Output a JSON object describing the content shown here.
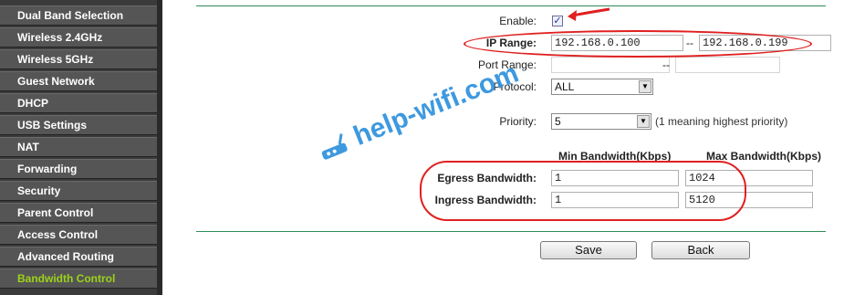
{
  "sidebar": {
    "items": [
      {
        "label": "Dual Band Selection"
      },
      {
        "label": "Wireless 2.4GHz"
      },
      {
        "label": "Wireless 5GHz"
      },
      {
        "label": "Guest Network"
      },
      {
        "label": "DHCP"
      },
      {
        "label": "USB Settings"
      },
      {
        "label": "NAT"
      },
      {
        "label": "Forwarding"
      },
      {
        "label": "Security"
      },
      {
        "label": "Parent Control"
      },
      {
        "label": "Access Control"
      },
      {
        "label": "Advanced Routing"
      },
      {
        "label": "Bandwidth Control"
      }
    ],
    "active_index": 12,
    "active_color": "#9bd31a"
  },
  "form": {
    "enable": {
      "label": "Enable:",
      "checked": true
    },
    "ip_range": {
      "label": "IP Range:",
      "start": "192.168.0.100",
      "separator": "--",
      "end": "192.168.0.199"
    },
    "port_range": {
      "label": "Port Range:",
      "start": "",
      "separator": "--",
      "end": ""
    },
    "protocol": {
      "label": "Protocol:",
      "value": "ALL"
    },
    "priority": {
      "label": "Priority:",
      "value": "5",
      "hint": "(1 meaning highest priority)"
    },
    "columns": {
      "min": "Min Bandwidth(Kbps)",
      "max": "Max Bandwidth(Kbps)"
    },
    "egress": {
      "label": "Egress Bandwidth:",
      "min": "1",
      "max": "1024"
    },
    "ingress": {
      "label": "Ingress Bandwidth:",
      "min": "1",
      "max": "5120"
    }
  },
  "buttons": {
    "save": "Save",
    "back": "Back"
  },
  "watermark": "help-wifi.com",
  "annotation_color": "#e02020"
}
